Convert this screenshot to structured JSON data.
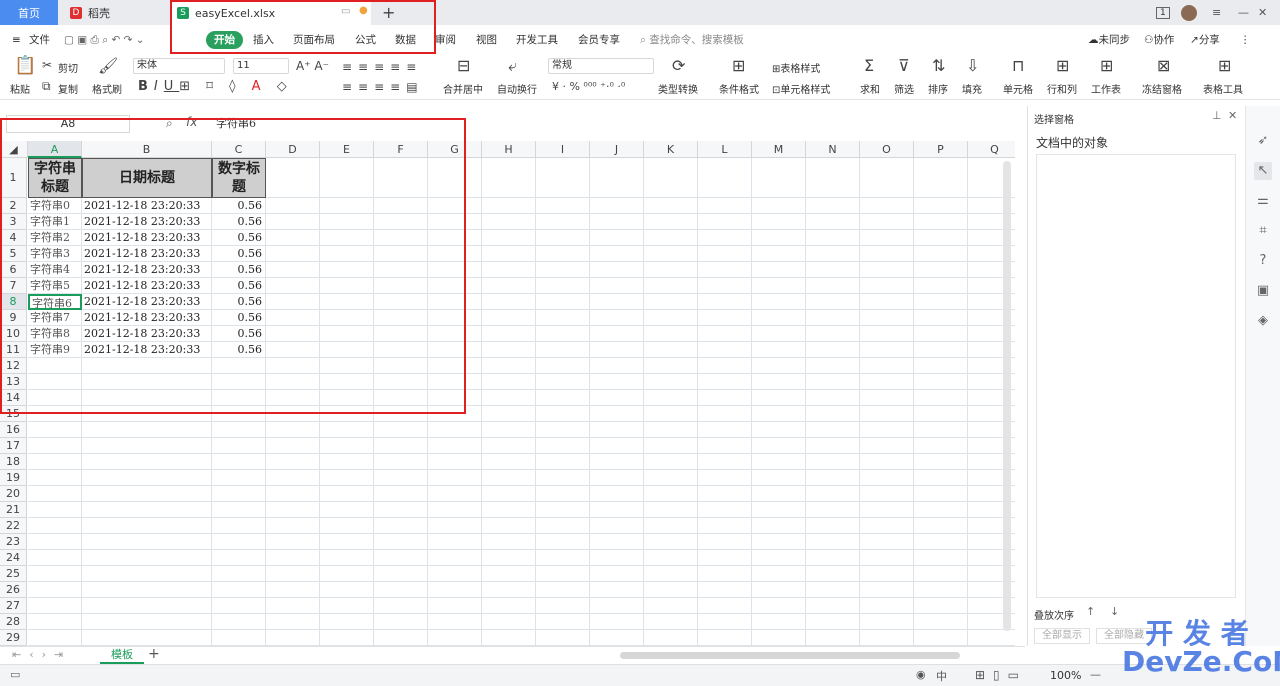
{
  "tabs": {
    "home": "首页",
    "daoke": "稻壳",
    "file": "easyExcel.xlsx",
    "new_tab": "+",
    "badge": "1"
  },
  "menubar": {
    "file": "文件",
    "items": [
      "开始",
      "插入",
      "页面布局",
      "公式",
      "数据",
      "审阅",
      "视图",
      "开发工具",
      "会员专享"
    ],
    "search": "查找命令、搜索模板",
    "unsync": "未同步",
    "collab": "协作",
    "share": "分享"
  },
  "ribbon": {
    "paste": "粘贴",
    "cut": "剪切",
    "copy": "复制",
    "format_painter": "格式刷",
    "font_name": "宋体",
    "font_size": "11",
    "merge_center": "合并居中",
    "wrap_text": "自动换行",
    "number_format": "常规",
    "type_convert": "类型转换",
    "cond_format": "条件格式",
    "table_style": "表格样式",
    "cell_style": "单元格样式",
    "sum": "求和",
    "filter": "筛选",
    "sort": "排序",
    "fill": "填充",
    "cell": "单元格",
    "row_col": "行和列",
    "worksheet": "工作表",
    "freeze": "冻结窗格",
    "table_tools": "表格工具"
  },
  "formula": {
    "cell_ref": "A8",
    "fx": "fx",
    "value": "字符串6"
  },
  "columns": [
    "A",
    "B",
    "C",
    "D",
    "E",
    "F",
    "G",
    "H",
    "I",
    "J",
    "K",
    "L",
    "M",
    "N",
    "O",
    "P",
    "Q"
  ],
  "rows": [
    "1",
    "2",
    "3",
    "4",
    "5",
    "6",
    "7",
    "8",
    "9",
    "10",
    "11",
    "12",
    "13",
    "14",
    "15",
    "16",
    "17",
    "18",
    "19",
    "20",
    "21",
    "22",
    "23",
    "24",
    "25",
    "26",
    "27",
    "28",
    "29"
  ],
  "headers": [
    "字符串标题",
    "日期标题",
    "数字标题"
  ],
  "data": [
    [
      "字符串0",
      "2021-12-18  23:20:33",
      "0.56"
    ],
    [
      "字符串1",
      "2021-12-18  23:20:33",
      "0.56"
    ],
    [
      "字符串2",
      "2021-12-18  23:20:33",
      "0.56"
    ],
    [
      "字符串3",
      "2021-12-18  23:20:33",
      "0.56"
    ],
    [
      "字符串4",
      "2021-12-18  23:20:33",
      "0.56"
    ],
    [
      "字符串5",
      "2021-12-18  23:20:33",
      "0.56"
    ],
    [
      "字符串6",
      "2021-12-18  23:20:33",
      "0.56"
    ],
    [
      "字符串7",
      "2021-12-18  23:20:33",
      "0.56"
    ],
    [
      "字符串8",
      "2021-12-18  23:20:33",
      "0.56"
    ],
    [
      "字符串9",
      "2021-12-18  23:20:33",
      "0.56"
    ]
  ],
  "rpanel": {
    "title": "选择窗格",
    "objects": "文档中的对象",
    "order": "叠放次序",
    "show_all": "全部显示",
    "hide_all": "全部隐藏"
  },
  "sheets": {
    "active": "模板",
    "add": "+"
  },
  "status": {
    "zoom": "100%",
    "cn": "中"
  },
  "watermark": "开 发 者\nDevZe.CoM"
}
